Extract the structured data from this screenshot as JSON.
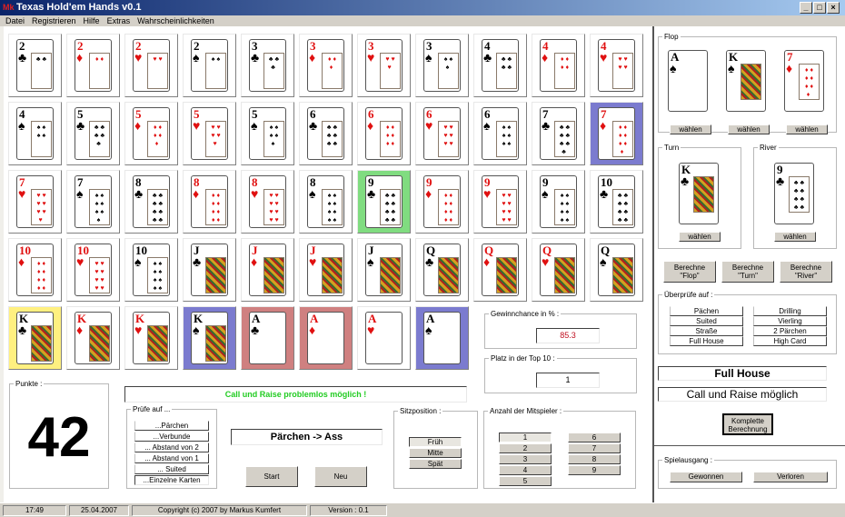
{
  "window": {
    "title": "Texas Hold'em Hands v0.1",
    "icon": "app-logo-icon",
    "controls": [
      "minimize",
      "maximize",
      "close"
    ]
  },
  "menu": [
    "Datei",
    "Registrieren",
    "Hilfe",
    "Extras",
    "Wahrscheinlichkeiten"
  ],
  "card_grid": [
    {
      "rank": "2",
      "suit": "clubs"
    },
    {
      "rank": "2",
      "suit": "diamonds"
    },
    {
      "rank": "2",
      "suit": "hearts"
    },
    {
      "rank": "2",
      "suit": "spades"
    },
    {
      "rank": "3",
      "suit": "clubs"
    },
    {
      "rank": "3",
      "suit": "diamonds"
    },
    {
      "rank": "3",
      "suit": "hearts"
    },
    {
      "rank": "3",
      "suit": "spades"
    },
    {
      "rank": "4",
      "suit": "clubs"
    },
    {
      "rank": "4",
      "suit": "diamonds"
    },
    {
      "rank": "4",
      "suit": "hearts"
    },
    {
      "rank": "4",
      "suit": "spades"
    },
    {
      "rank": "5",
      "suit": "clubs"
    },
    {
      "rank": "5",
      "suit": "diamonds"
    },
    {
      "rank": "5",
      "suit": "hearts"
    },
    {
      "rank": "5",
      "suit": "spades"
    },
    {
      "rank": "6",
      "suit": "clubs"
    },
    {
      "rank": "6",
      "suit": "diamonds"
    },
    {
      "rank": "6",
      "suit": "hearts"
    },
    {
      "rank": "6",
      "suit": "spades"
    },
    {
      "rank": "7",
      "suit": "clubs"
    },
    {
      "rank": "7",
      "suit": "diamonds",
      "highlight": "blue"
    },
    {
      "rank": "7",
      "suit": "hearts"
    },
    {
      "rank": "7",
      "suit": "spades"
    },
    {
      "rank": "8",
      "suit": "clubs"
    },
    {
      "rank": "8",
      "suit": "diamonds"
    },
    {
      "rank": "8",
      "suit": "hearts"
    },
    {
      "rank": "8",
      "suit": "spades"
    },
    {
      "rank": "9",
      "suit": "clubs",
      "highlight": "green"
    },
    {
      "rank": "9",
      "suit": "diamonds"
    },
    {
      "rank": "9",
      "suit": "hearts"
    },
    {
      "rank": "9",
      "suit": "spades"
    },
    {
      "rank": "10",
      "suit": "clubs"
    },
    {
      "rank": "10",
      "suit": "diamonds"
    },
    {
      "rank": "10",
      "suit": "hearts"
    },
    {
      "rank": "10",
      "suit": "spades"
    },
    {
      "rank": "J",
      "suit": "clubs"
    },
    {
      "rank": "J",
      "suit": "diamonds"
    },
    {
      "rank": "J",
      "suit": "hearts"
    },
    {
      "rank": "J",
      "suit": "spades"
    },
    {
      "rank": "Q",
      "suit": "clubs"
    },
    {
      "rank": "Q",
      "suit": "diamonds"
    },
    {
      "rank": "Q",
      "suit": "hearts"
    },
    {
      "rank": "Q",
      "suit": "spades"
    },
    {
      "rank": "K",
      "suit": "clubs",
      "highlight": "yellow"
    },
    {
      "rank": "K",
      "suit": "diamonds"
    },
    {
      "rank": "K",
      "suit": "hearts"
    },
    {
      "rank": "K",
      "suit": "spades",
      "highlight": "blue"
    },
    {
      "rank": "A",
      "suit": "clubs",
      "highlight": "red"
    },
    {
      "rank": "A",
      "suit": "diamonds",
      "highlight": "red"
    },
    {
      "rank": "A",
      "suit": "hearts"
    },
    {
      "rank": "A",
      "suit": "spades",
      "highlight": "blue"
    }
  ],
  "highlight_colors": {
    "blue": "#7b7bcf",
    "red": "#cf8080",
    "green": "#80dc80",
    "yellow": "#fff080"
  },
  "points": {
    "label": "Punkte :",
    "value": "42"
  },
  "advice_banner": {
    "text": "Call und Raise problemlos möglich !",
    "color": "#22cc22"
  },
  "win_chance": {
    "label": "Gewinnchance in % :",
    "value": "85.3",
    "color": "#c01020"
  },
  "top10": {
    "label": "Platz in der Top 10 :",
    "value": "1"
  },
  "check_for": {
    "label": "Prüfe auf ...",
    "items": [
      "...Pärchen",
      "...Verbunde",
      "... Abstand von 2",
      "... Abstand von 1",
      "... Suited",
      "...Einzelne Karten"
    ]
  },
  "hand_display": "Pärchen -> Ass",
  "buttons": {
    "start": "Start",
    "new": "Neu"
  },
  "seat_position": {
    "label": "Sitzposition :",
    "options": [
      "Früh",
      "Mitte",
      "Spät"
    ],
    "selected": "Früh"
  },
  "players": {
    "label": "Anzahl der Mitspieler :",
    "options": [
      "1",
      "2",
      "3",
      "4",
      "5",
      "6",
      "7",
      "8",
      "9"
    ],
    "selected": "1"
  },
  "flop": {
    "label": "Flop",
    "cards": [
      {
        "rank": "A",
        "suit": "spades"
      },
      {
        "rank": "K",
        "suit": "spades"
      },
      {
        "rank": "7",
        "suit": "diamonds"
      }
    ],
    "choose_label": "wählen"
  },
  "turn": {
    "label": "Turn",
    "card": {
      "rank": "K",
      "suit": "clubs"
    },
    "choose_label": "wählen"
  },
  "river": {
    "label": "River",
    "card": {
      "rank": "9",
      "suit": "clubs"
    },
    "choose_label": "wählen"
  },
  "calc_buttons": [
    "Berechne \"Flop\"",
    "Berechne \"Turn\"",
    "Berechne \"River\""
  ],
  "check_hands": {
    "label": "Überprüfe auf :",
    "left": [
      "Pächen",
      "Suited",
      "Straße",
      "Full House"
    ],
    "right": [
      "Drilling",
      "Vierling",
      "2 Pärchen",
      "High Card"
    ]
  },
  "result_hand": "Full House",
  "result_advice": "Call und Raise möglich",
  "full_calc_button": "Komplette Berechnung",
  "outcome": {
    "label": "Spielausgang :",
    "won": "Gewonnen",
    "lost": "Verloren"
  },
  "statusbar": {
    "time": "17:49",
    "date": "25.04.2007",
    "copyright": "Copyright (c) 2007 by Markus Kumfert",
    "version": "Version : 0.1"
  }
}
